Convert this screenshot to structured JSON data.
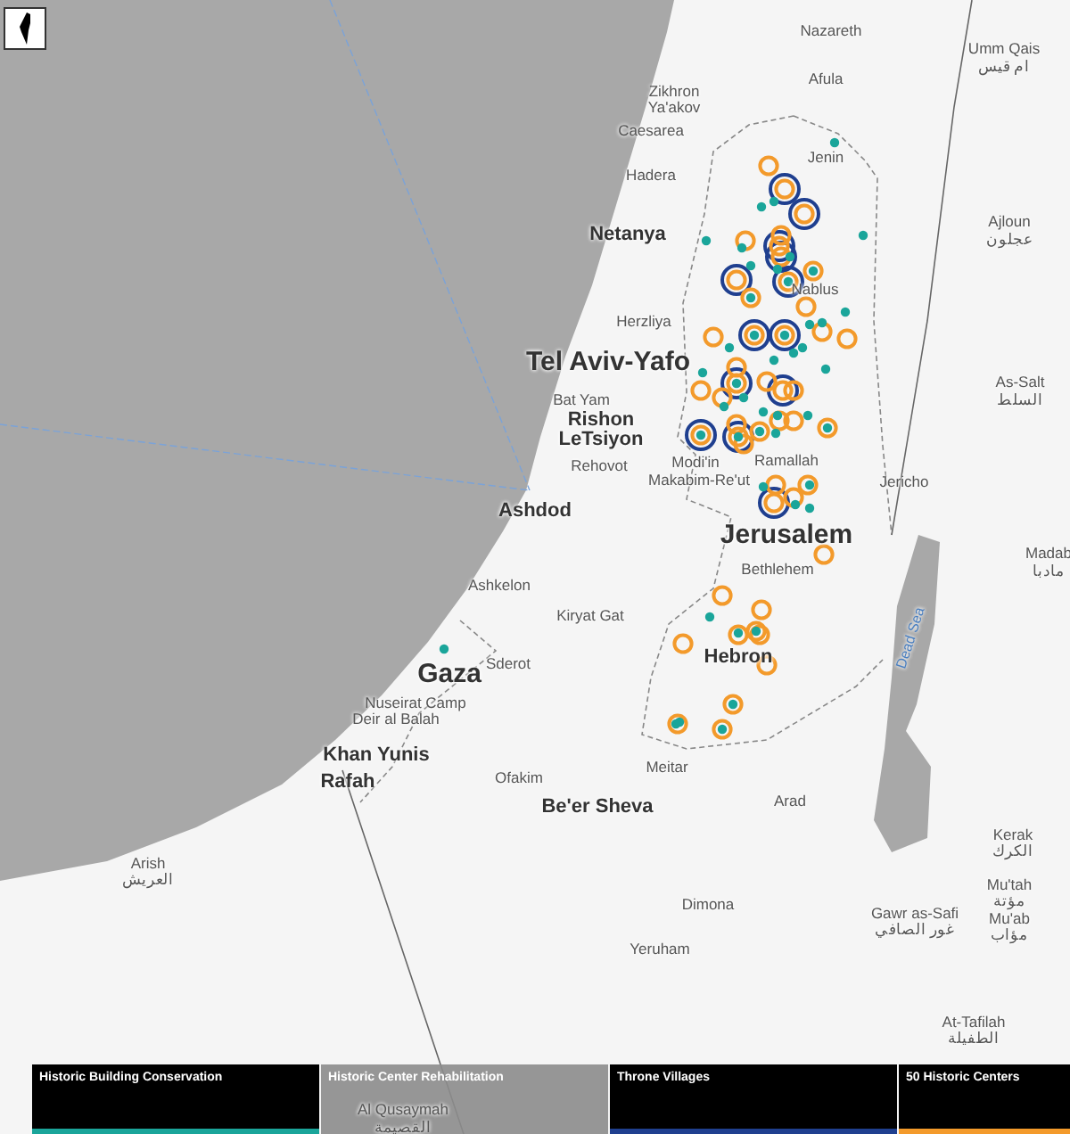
{
  "map": {
    "labels": [
      {
        "text": "Nazareth",
        "kind": "town"
      },
      {
        "text": "Umm Qais",
        "kind": "town"
      },
      {
        "text": "ام قيس",
        "kind": "town"
      },
      {
        "text": "Afula",
        "kind": "town"
      },
      {
        "text": "Zikhron",
        "kind": "town"
      },
      {
        "text": "Ya'akov",
        "kind": "town"
      },
      {
        "text": "Caesarea",
        "kind": "town"
      },
      {
        "text": "Hadera",
        "kind": "town"
      },
      {
        "text": "Jenin",
        "kind": "town"
      },
      {
        "text": "Netanya",
        "kind": "city"
      },
      {
        "text": "Ajloun",
        "kind": "town"
      },
      {
        "text": "عجلون",
        "kind": "town"
      },
      {
        "text": "Nablus",
        "kind": "town"
      },
      {
        "text": "Herzliya",
        "kind": "town"
      },
      {
        "text": "Tel Aviv-Yafo",
        "kind": "major"
      },
      {
        "text": "As-Salt",
        "kind": "town"
      },
      {
        "text": "السلط",
        "kind": "town"
      },
      {
        "text": "Bat Yam",
        "kind": "town"
      },
      {
        "text": "Rishon",
        "kind": "city"
      },
      {
        "text": "LeTsiyon",
        "kind": "city"
      },
      {
        "text": "Rehovot",
        "kind": "town"
      },
      {
        "text": "Modi'in",
        "kind": "town"
      },
      {
        "text": "Makabim-Re'ut",
        "kind": "town"
      },
      {
        "text": "Ramallah",
        "kind": "town"
      },
      {
        "text": "Jericho",
        "kind": "town"
      },
      {
        "text": "Ashdod",
        "kind": "city"
      },
      {
        "text": "Jerusalem",
        "kind": "major"
      },
      {
        "text": "Madab",
        "kind": "town"
      },
      {
        "text": "مادبا",
        "kind": "town"
      },
      {
        "text": "Bethlehem",
        "kind": "town"
      },
      {
        "text": "Ashkelon",
        "kind": "town"
      },
      {
        "text": "Kiryat Gat",
        "kind": "town"
      },
      {
        "text": "Dead Sea",
        "kind": "water"
      },
      {
        "text": "Sderot",
        "kind": "town"
      },
      {
        "text": "Gaza",
        "kind": "major"
      },
      {
        "text": "Hebron",
        "kind": "city"
      },
      {
        "text": "Nuseirat Camp",
        "kind": "town"
      },
      {
        "text": "Deir al Balah",
        "kind": "town"
      },
      {
        "text": "Khan Yunis",
        "kind": "city"
      },
      {
        "text": "Rafah",
        "kind": "city"
      },
      {
        "text": "Ofakim",
        "kind": "town"
      },
      {
        "text": "Meitar",
        "kind": "town"
      },
      {
        "text": "Arad",
        "kind": "town"
      },
      {
        "text": "Be'er Sheva",
        "kind": "city"
      },
      {
        "text": "Kerak",
        "kind": "town"
      },
      {
        "text": "الكرك",
        "kind": "town"
      },
      {
        "text": "Arish",
        "kind": "town"
      },
      {
        "text": "العريش",
        "kind": "town"
      },
      {
        "text": "Mu'tah",
        "kind": "town"
      },
      {
        "text": "مؤتة",
        "kind": "town"
      },
      {
        "text": "Mu'ab",
        "kind": "town"
      },
      {
        "text": "مؤاب",
        "kind": "town"
      },
      {
        "text": "Dimona",
        "kind": "town"
      },
      {
        "text": "Gawr as-Safi",
        "kind": "town"
      },
      {
        "text": "غور الصافي",
        "kind": "town"
      },
      {
        "text": "Yeruham",
        "kind": "town"
      },
      {
        "text": "At-Tafilah",
        "kind": "town"
      },
      {
        "text": "الطفيلة",
        "kind": "town"
      },
      {
        "text": "Al Qusaymah",
        "kind": "town"
      },
      {
        "text": "القصيمة",
        "kind": "town"
      }
    ]
  },
  "layers": [
    {
      "label": "Historic Building Conservation",
      "on": true,
      "color": "#1aa59a"
    },
    {
      "label": "Historic Center Rehabilitation",
      "on": false
    },
    {
      "label": "Throne Villages",
      "on": true,
      "color": "#1f3f8f"
    },
    {
      "label": "50 Historic Centers",
      "on": true,
      "color": "#f39a2b"
    }
  ]
}
